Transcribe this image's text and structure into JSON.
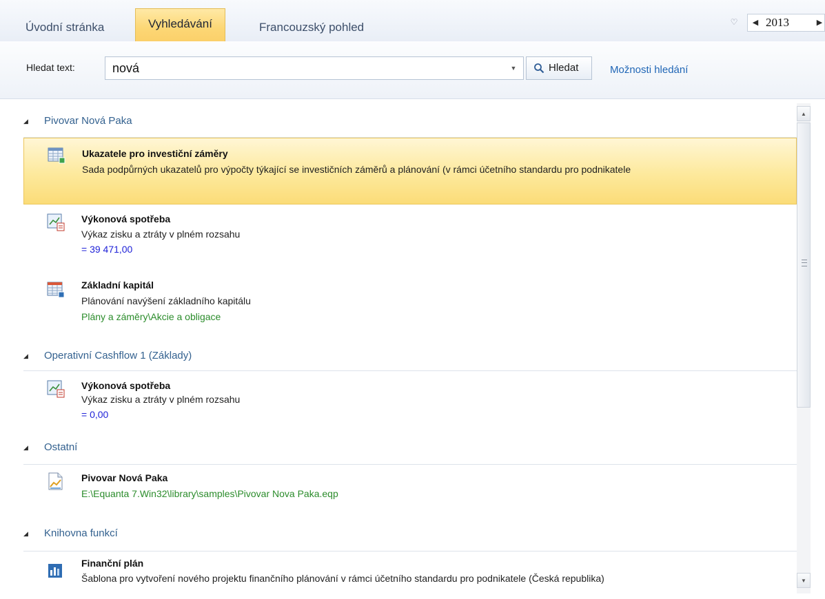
{
  "tabs": [
    {
      "label": "Úvodní stránka"
    },
    {
      "label": "Vyhledávání",
      "active": true
    },
    {
      "label": "Francouzský pohled"
    }
  ],
  "year": {
    "value": "2013"
  },
  "search": {
    "label": "Hledat text:",
    "value": "nová",
    "button_label": "Hledat",
    "options_link": "Možnosti hledání"
  },
  "groups": [
    {
      "title": "Pivovar Nová Paka",
      "items": [
        {
          "icon": "table-icon",
          "title": "Ukazatele pro investiční záměry",
          "description": "Sada podpůrných ukazatelů pro výpočty týkající se investičních záměrů a plánování (v rámci účetního standardu pro podnikatele",
          "selected": true
        },
        {
          "icon": "chart-report-icon",
          "title": "Výkonová spotřeba",
          "description": "Výkaz zisku a ztráty v plném rozsahu",
          "value": "= 39 471,00"
        },
        {
          "icon": "table-icon",
          "title": "Základní kapitál",
          "description": "Plánování navýšení základního kapitálu",
          "path": "Plány a záměry\\Akcie a obligace"
        }
      ]
    },
    {
      "title": "Operativní Cashflow 1 (Základy)",
      "items": [
        {
          "icon": "chart-report-icon",
          "title": "Výkonová spotřeba",
          "description": "Výkaz zisku a ztráty v plném rozsahu",
          "value": "= 0,00"
        }
      ]
    },
    {
      "title": "Ostatní",
      "items": [
        {
          "icon": "project-file-icon",
          "title": "Pivovar Nová Paka",
          "path": "E:\\Equanta 7.Win32\\library\\samples\\Pivovar Nova Paka.eqp"
        }
      ]
    },
    {
      "title": "Knihovna funkcí",
      "items": [
        {
          "icon": "template-icon",
          "title": "Finanční plán",
          "description": "Šablona pro vytvoření nového projektu finančního plánování v rámci účetního standardu pro podnikatele (Česká republika)"
        }
      ]
    }
  ],
  "icons": {
    "favorite": "heart-icon",
    "year_prev": "chevron-left-icon",
    "year_next": "chevron-right-icon",
    "search": "magnifier-icon",
    "dropdown": "chevron-down-icon"
  },
  "colors": {
    "active_tab": "#fcd775",
    "selected_item": "#fde99c",
    "group_title": "#33618f",
    "value_text": "#1f22d8",
    "path_text": "#2b8c2b",
    "link": "#2066b6"
  }
}
